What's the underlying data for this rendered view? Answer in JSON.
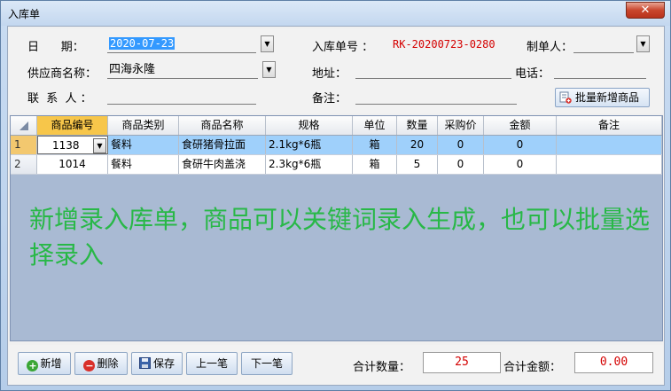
{
  "window": {
    "title": "入库单",
    "close": "✕"
  },
  "form": {
    "date_label": "日      期：",
    "date_value": "2020-07-23",
    "order_no_label": "入库单号 ：",
    "order_no_value": "RK-20200723-0280",
    "maker_label": "制单人：",
    "maker_value": "",
    "supplier_label": "供应商名称：",
    "supplier_value": "四海永隆",
    "address_label": "地址：",
    "address_value": "",
    "phone_label": "电话：",
    "phone_value": "",
    "contact_label": "联  系  人 ：",
    "contact_value": "",
    "remark_label": "备注：",
    "remark_value": "",
    "batch_add_label": "批量新增商品"
  },
  "grid": {
    "columns": [
      "商品编号",
      "商品类别",
      "商品名称",
      "规格",
      "单位",
      "数量",
      "采购价",
      "金额",
      "备注"
    ],
    "rows": [
      {
        "num": "1",
        "code": "1138",
        "category": "餐料",
        "name": "食研猪骨拉面",
        "spec": "2.1kg*6瓶",
        "unit": "箱",
        "qty": "20",
        "price": "0",
        "amount": "0",
        "remark": ""
      },
      {
        "num": "2",
        "code": "1014",
        "category": "餐料",
        "name": "食研牛肉盖浇",
        "spec": "2.3kg*6瓶",
        "unit": "箱",
        "qty": "5",
        "price": "0",
        "amount": "0",
        "remark": ""
      }
    ]
  },
  "overlay_note": "新增录入库单，商品可以关键词录入生成，也可以批量选择录入",
  "toolbar": {
    "add": "新增",
    "delete": "删除",
    "save": "保存",
    "prev": "上一笔",
    "next": "下一笔"
  },
  "summary": {
    "qty_label": "合计数量：",
    "qty_value": "25",
    "amount_label": "合计金额：",
    "amount_value": "0.00"
  },
  "colors": {
    "selected_row": "#9fd0fb",
    "note_text": "#28b847",
    "order_no": "#d40000"
  }
}
